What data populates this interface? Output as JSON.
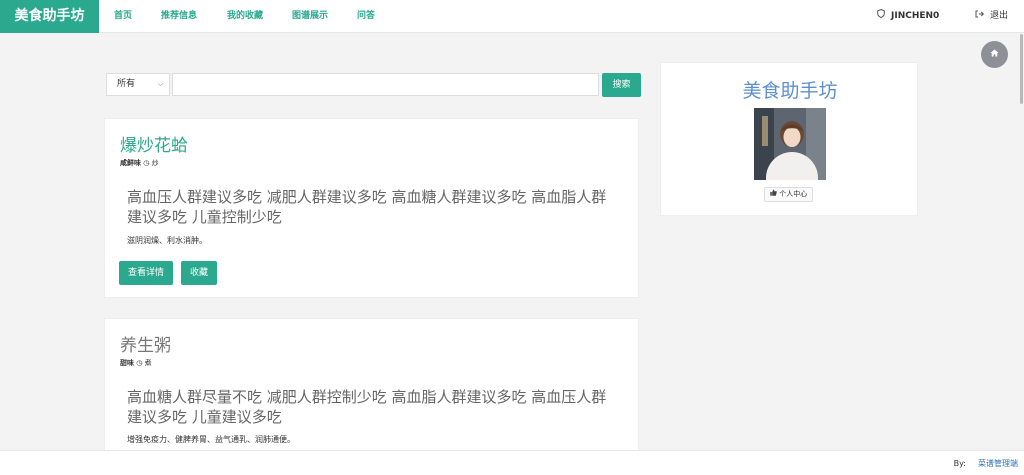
{
  "header": {
    "brand": "美食助手坊",
    "nav": [
      "首页",
      "推荐信息",
      "我的收藏",
      "图谱展示",
      "问答"
    ],
    "username": "JINCHEN0",
    "logout": "退出"
  },
  "search": {
    "category_selected": "所有",
    "query_value": "",
    "button_label": "搜索"
  },
  "cards": [
    {
      "title": "爆炒花蛤",
      "taste": "咸鲜味",
      "method": "炒",
      "description": "高血压人群建议多吃 减肥人群建议多吃 高血糖人群建议多吃 高血脂人群建议多吃 儿童控制少吃",
      "effect": "滋阴润燥、利水消肿。",
      "detail_button": "查看详情",
      "collect_button": "收藏"
    },
    {
      "title": "养生粥",
      "taste": "甜味",
      "method": "煮",
      "description": "高血糖人群尽量不吃 减肥人群控制少吃 高血脂人群建议多吃 高血压人群建议多吃 儿童建议多吃",
      "effect": "增强免疫力、健脾养胃、益气通乳、润肺通便。"
    }
  ],
  "sidebar": {
    "title": "美食助手坊",
    "profile_button": "个人中心"
  },
  "footer": {
    "by_label": "By:",
    "link": "菜谱管理端"
  },
  "colors": {
    "accent": "#2aa98f",
    "sidebar_title": "#5c8fd0",
    "link": "#2e72b8"
  },
  "icons": [
    "shield-icon",
    "logout-icon",
    "home-icon",
    "clock-icon",
    "thumbs-up-icon",
    "chevron-down-icon"
  ]
}
